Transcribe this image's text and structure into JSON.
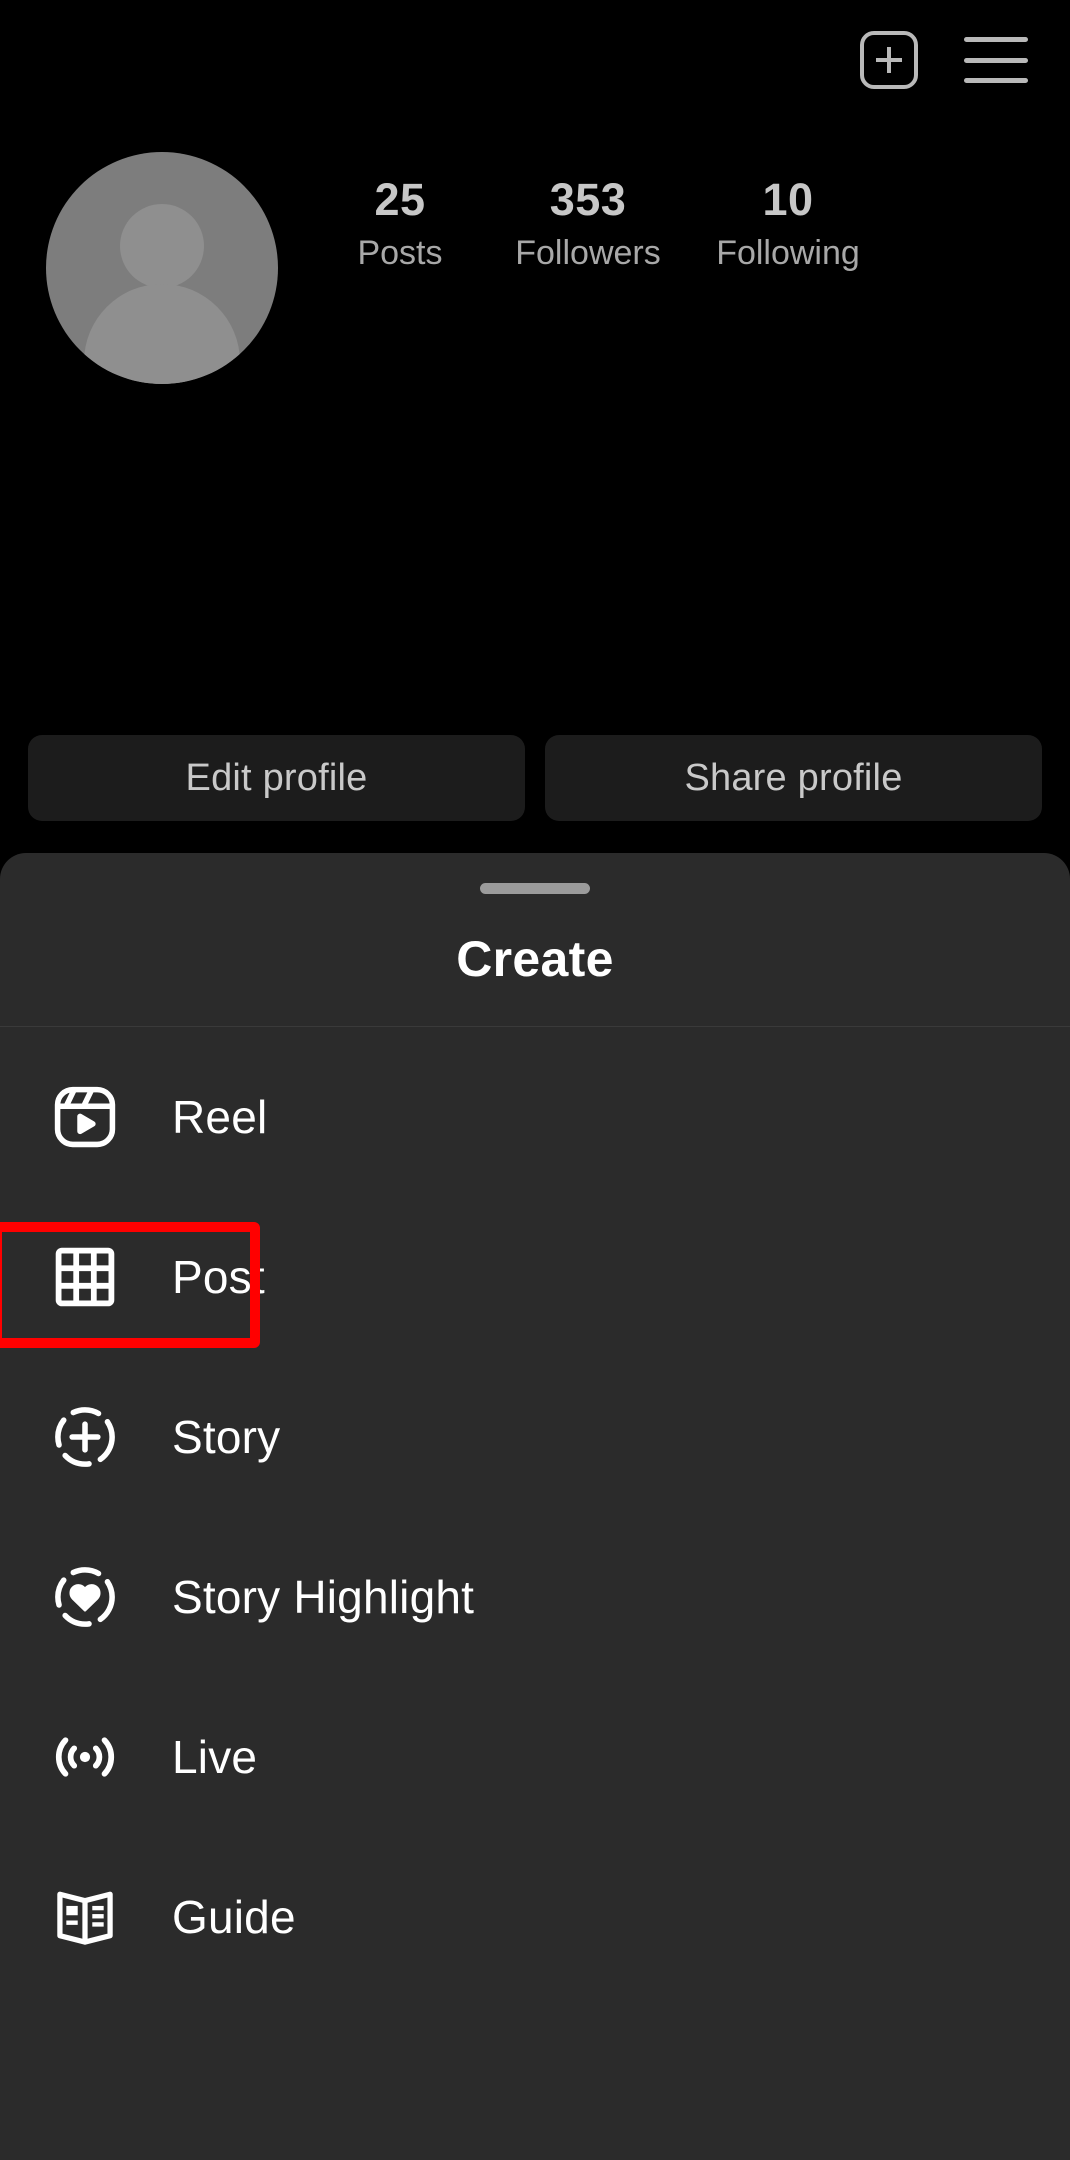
{
  "app": {
    "screen_name": "Instagram profile",
    "theme": "dark",
    "background_color": "#000000",
    "sheet_color": "#2b2b2b",
    "highlight_color": "#ff0000"
  },
  "topbar": {
    "add_icon": "plus-box-icon",
    "menu_icon": "hamburger-menu-icon"
  },
  "profile": {
    "avatar_icon": "default-avatar-icon",
    "stats": [
      {
        "value": "25",
        "label": "Posts"
      },
      {
        "value": "353",
        "label": "Followers"
      },
      {
        "value": "10",
        "label": "Following"
      }
    ]
  },
  "actions": {
    "edit_profile": "Edit profile",
    "share_profile": "Share profile"
  },
  "sheet": {
    "title": "Create",
    "handle": "drag-handle",
    "items": [
      {
        "label": "Reel",
        "icon": "reel-icon"
      },
      {
        "label": "Post",
        "icon": "grid-post-icon",
        "highlighted": true
      },
      {
        "label": "Story",
        "icon": "story-plus-icon"
      },
      {
        "label": "Story Highlight",
        "icon": "story-highlight-heart-icon"
      },
      {
        "label": "Live",
        "icon": "live-broadcast-icon"
      },
      {
        "label": "Guide",
        "icon": "guide-book-icon"
      }
    ]
  }
}
